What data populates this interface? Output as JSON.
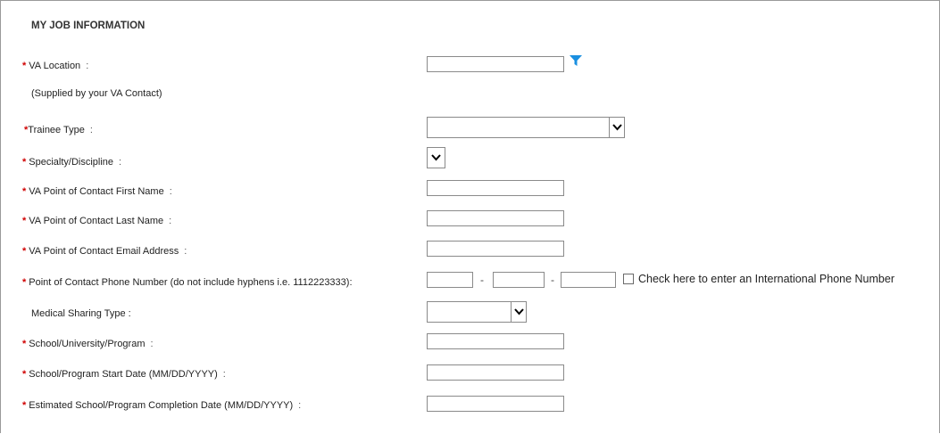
{
  "section": {
    "title": "MY JOB INFORMATION"
  },
  "required_marker": "*",
  "colon": ":",
  "fields": {
    "va_location": {
      "label": "VA Location",
      "value": ""
    },
    "va_location_note": "(Supplied by your VA Contact)",
    "trainee_type": {
      "label": "Trainee Type",
      "value": ""
    },
    "specialty": {
      "label": "Specialty/Discipline",
      "value": ""
    },
    "poc_first_name": {
      "label": "VA Point of Contact First Name",
      "value": ""
    },
    "poc_last_name": {
      "label": "VA Point of Contact Last Name",
      "value": ""
    },
    "poc_email": {
      "label": "VA Point of Contact Email Address",
      "value": ""
    },
    "poc_phone": {
      "label": "Point of Contact Phone Number (do not include hyphens i.e. 1112223333):",
      "area": "",
      "prefix": "",
      "line": "",
      "separator": "-",
      "international_label": "Check here to enter an International Phone Number",
      "international_checked": false
    },
    "medical_sharing_type": {
      "label": "Medical Sharing Type :",
      "value": ""
    },
    "school": {
      "label": "School/University/Program",
      "value": ""
    },
    "start_date": {
      "label": "School/Program Start Date (MM/DD/YYYY)",
      "value": ""
    },
    "completion_date": {
      "label": "Estimated School/Program Completion Date (MM/DD/YYYY)",
      "value": ""
    }
  },
  "icons": {
    "filter": "filter-funnel-icon",
    "dropdown": "chevron-down-icon"
  },
  "colors": {
    "required": "#d00000",
    "filter_icon": "#1a8fe0"
  }
}
